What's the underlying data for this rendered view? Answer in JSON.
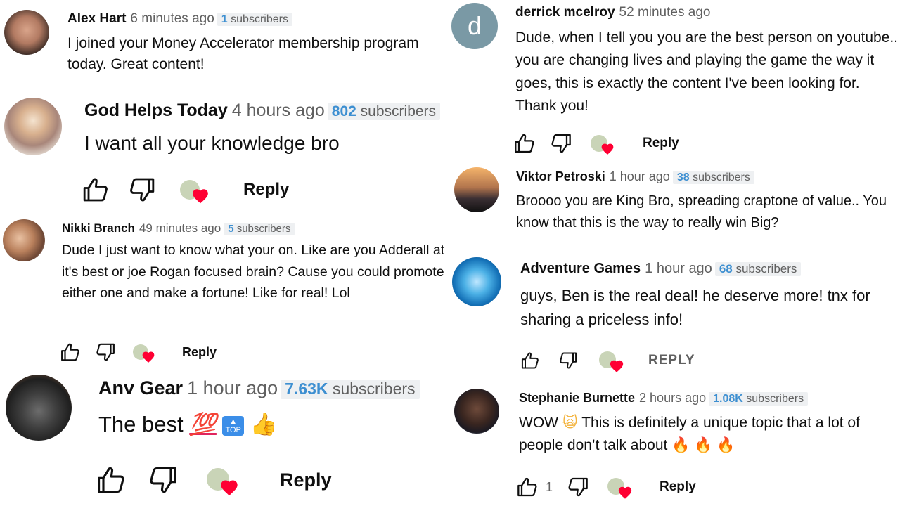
{
  "colors": {
    "author": "#0f0f0f",
    "meta": "#606060",
    "subs_bg": "#eef0f2",
    "subs_number": "#3d8fd1",
    "heart": "#ff0033"
  },
  "icons": {
    "like": "thumb-up-icon",
    "dislike": "thumb-down-icon",
    "creator_heart": "heart-icon"
  },
  "comments": [
    {
      "author": "Alex Hart",
      "time": "6 minutes ago",
      "subs_count": "1",
      "subs_label": "subscribers",
      "text": "I joined your Money Accelerator membership program today. Great content!"
    },
    {
      "author": "God Helps Today",
      "time": "4 hours ago",
      "subs_count": "802",
      "subs_label": "subscribers",
      "text": "I want all your knowledge bro",
      "reply": "Reply"
    },
    {
      "author": "Nikki Branch",
      "time": "49 minutes ago",
      "subs_count": "5",
      "subs_label": "subscribers",
      "text": "Dude I just want to know what your on. Like are you Adderall at it's best or joe Rogan focused brain? Cause you could promote either one and make a fortune! Like for real! Lol",
      "reply": "Reply"
    },
    {
      "author": "Anv Gear",
      "time": "1 hour ago",
      "subs_count": "7.63K",
      "subs_label": "subscribers",
      "text": "The best",
      "emoji_hundred": "💯",
      "emoji_top": "TOP",
      "emoji_thumb": "👍",
      "reply": "Reply"
    },
    {
      "author": "derrick mcelroy",
      "time": "52 minutes ago",
      "avatar_letter": "d",
      "text": "Dude, when I tell you you are the best person on youtube.. you are changing lives and playing the game the way it goes, this is exactly the content I've been looking for. Thank you!",
      "reply": "Reply"
    },
    {
      "author": "Viktor Petroski",
      "time": "1 hour ago",
      "subs_count": "38",
      "subs_label": "subscribers",
      "text": "Broooo you are King Bro, spreading craptone of  value.. You know that this is the way to really win Big?"
    },
    {
      "author": "Adventure Games",
      "time": "1 hour ago",
      "subs_count": "68",
      "subs_label": "subscribers",
      "text": "guys, Ben is the real deal! he deserve more! tnx for sharing a priceless info!",
      "reply": "REPLY"
    },
    {
      "author": "Stephanie Burnette",
      "time": "2 hours ago",
      "subs_count": "1.08K",
      "subs_label": "subscribers",
      "text_a": "WOW",
      "emoji_scream": "🙀",
      "text_b": "This is definitely a unique topic that a lot of people don’t talk about",
      "emoji_fire": "🔥",
      "like_count": "1",
      "reply": "Reply"
    }
  ]
}
